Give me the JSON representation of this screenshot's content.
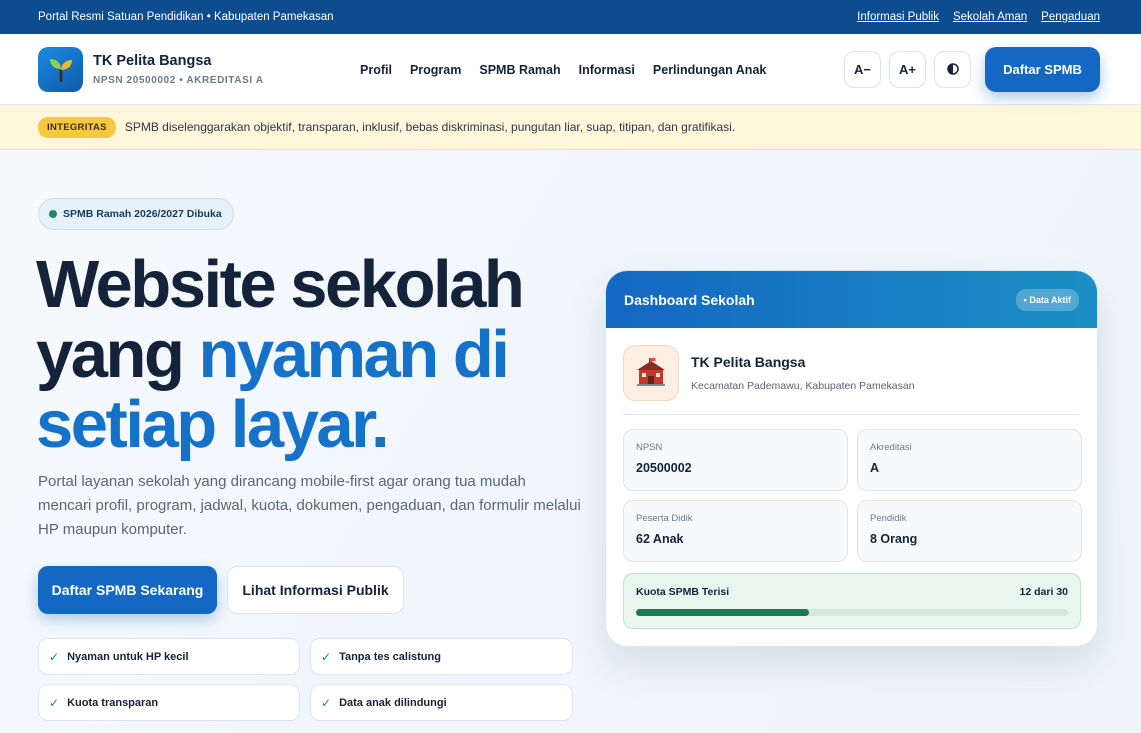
{
  "topbar": {
    "portal_text": "Portal Resmi Satuan Pendidikan • Kabupaten Pamekasan",
    "links": [
      "Informasi Publik",
      "Sekolah Aman",
      "Pengaduan"
    ]
  },
  "header": {
    "school_name": "TK Pelita Bangsa",
    "school_meta": "NPSN 20500002 • AKREDITASI A",
    "nav": [
      "Profil",
      "Program",
      "SPMB Ramah",
      "Informasi",
      "Perlindungan Anak"
    ],
    "font_decrease": "A−",
    "font_increase": "A+",
    "contrast_icon": "contrast-icon",
    "cta_label": "Daftar SPMB"
  },
  "notice": {
    "badge": "INTEGRITAS",
    "text": "SPMB diselenggarakan objektif, transparan, inklusif, bebas diskriminasi, pungutan liar, suap, titipan, dan gratifikasi."
  },
  "hero": {
    "pill": "SPMB Ramah 2026/2027 Dibuka",
    "headline_line1": "Website sekolah",
    "headline_line2_dark": "yang ",
    "headline_line2_blue": "nyaman di",
    "headline_line3_blue": "setiap layar.",
    "lead": "Portal layanan sekolah yang dirancang mobile-first agar orang tua mudah mencari profil, program, jadwal, kuota, dokumen, pengaduan, dan formulir melalui HP maupun komputer.",
    "primary_button": "Daftar SPMB Sekarang",
    "secondary_button": "Lihat Informasi Publik",
    "features": [
      "Nyaman untuk HP kecil",
      "Tanpa tes calistung",
      "Kuota transparan",
      "Data anak dilindungi"
    ]
  },
  "dashboard": {
    "title": "Dashboard Sekolah",
    "status_tag": "• Data Aktif",
    "school_name": "TK Pelita Bangsa",
    "school_location": "Kecamatan Pademawu, Kabupaten Pamekasan",
    "stats": [
      {
        "label": "NPSN",
        "value": "20500002"
      },
      {
        "label": "Akreditasi",
        "value": "A"
      },
      {
        "label": "Peserta Didik",
        "value": "62 Anak"
      },
      {
        "label": "Pendidik",
        "value": "8 Orang"
      }
    ],
    "quota_label": "Kuota SPMB Terisi",
    "quota_text": "12 dari 30",
    "quota_filled": 12,
    "quota_total": 30
  },
  "colors": {
    "brand_blue": "#1467c2",
    "topbar_blue": "#0d4d8f",
    "success_green": "#1a7a52",
    "integrity_yellow": "#f5c93f"
  }
}
